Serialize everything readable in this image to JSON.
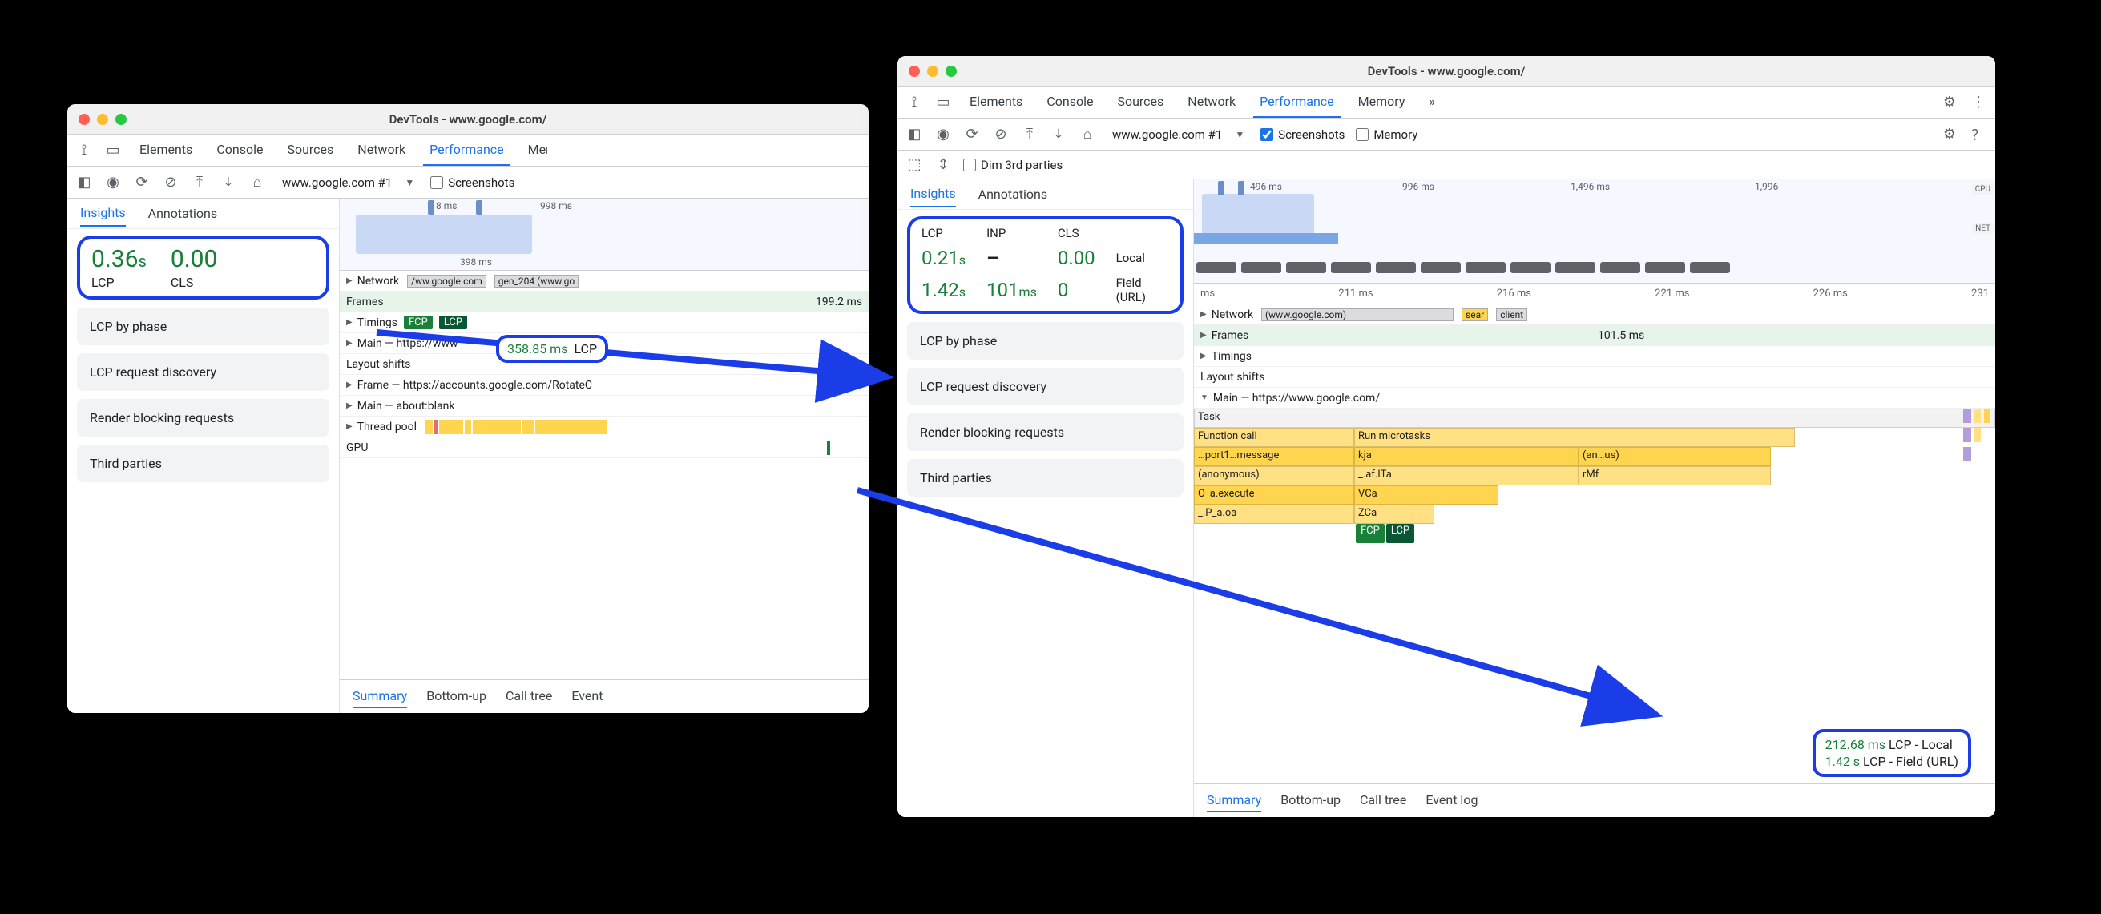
{
  "windowA": {
    "title": "DevTools - www.google.com/",
    "tabs": [
      "Elements",
      "Console",
      "Sources",
      "Network",
      "Performance",
      "Memory"
    ],
    "activeTab": "Performance",
    "profileDropdown": "www.google.com #1",
    "screenshots_label": "Screenshots",
    "insights_tabs": {
      "a": "Insights",
      "b": "Annotations"
    },
    "metrics": {
      "lcp_val": "0.36",
      "lcp_unit": "s",
      "lcp_label": "LCP",
      "cls_val": "0.00",
      "cls_label": "CLS"
    },
    "insightCards": [
      "LCP by phase",
      "LCP request discovery",
      "Render blocking requests",
      "Third parties"
    ],
    "minimap_ticks": {
      "a": "8 ms",
      "b": "998 ms",
      "c": "398 ms"
    },
    "tracks": {
      "network": "Network",
      "net_seg1": "/ww.google.com",
      "net_seg2": "gen_204 (www.go",
      "frames": "Frames",
      "frames_val": "199.2 ms",
      "timings": "Timings",
      "fcp": "FCP",
      "lcp": "LCP",
      "main": "Main — https://www",
      "layoutshifts": "Layout shifts",
      "frame": "Frame — https://accounts.google.com/RotateC",
      "main2": "Main — about:blank",
      "threadpool": "Thread pool",
      "gpu": "GPU"
    },
    "callout": {
      "ms": "358.85 ms",
      "label": "LCP"
    },
    "bottomTabs": [
      "Summary",
      "Bottom-up",
      "Call tree",
      "Event"
    ]
  },
  "windowB": {
    "title": "DevTools - www.google.com/",
    "tabs": [
      "Elements",
      "Console",
      "Sources",
      "Network",
      "Performance",
      "Memory"
    ],
    "more": "»",
    "activeTab": "Performance",
    "profileDropdown": "www.google.com #1",
    "screenshots_label": "Screenshots",
    "memory_label": "Memory",
    "dim_label": "Dim 3rd parties",
    "insights_tabs": {
      "a": "Insights",
      "b": "Annotations"
    },
    "metricsTable": {
      "h_lcp": "LCP",
      "h_inp": "INP",
      "h_cls": "CLS",
      "r1_lcp": "0.21",
      "r1_lcp_u": "s",
      "r1_inp": "–",
      "r1_cls": "0.00",
      "r1_side": "Local",
      "r2_lcp": "1.42",
      "r2_lcp_u": "s",
      "r2_inp": "101",
      "r2_inp_u": "ms",
      "r2_cls": "0",
      "r2_side": "Field (URL)"
    },
    "insightCards": [
      "LCP by phase",
      "LCP request discovery",
      "Render blocking requests",
      "Third parties"
    ],
    "minimap_ticks": {
      "a": "496 ms",
      "b": "996 ms",
      "c": "1,496 ms",
      "d": "1,996"
    },
    "mm_labels": {
      "cpu": "CPU",
      "net": "NET"
    },
    "ruler": [
      "ms",
      "211 ms",
      "216 ms",
      "221 ms",
      "226 ms",
      "231"
    ],
    "tracks": {
      "network": "Network",
      "net_seg1": "(www.google.com)",
      "net_seg2": "sear",
      "net_seg3": "client",
      "frames": "Frames",
      "frames_val": "101.5 ms",
      "timings": "Timings",
      "layoutshifts": "Layout shifts",
      "main": "Main — https://www.google.com/",
      "task": "Task",
      "fcall": "Function call",
      "microtasks": "Run microtasks",
      "port": "…port1…message",
      "kja": "kja",
      "anus": "(an…us)",
      "anon": "(anonymous)",
      "afita": "_.af.ITa",
      "rmf": "rMf",
      "oexec": "O_a.execute",
      "vca": "VCa",
      "paoa": "_.P_a.oa",
      "zca": "ZCa",
      "fcp": "FCP",
      "lcp": "LCP"
    },
    "callout": {
      "l1_ms": "212.68 ms",
      "l1_label": "LCP - Local",
      "l2_ms": "1.42 s",
      "l2_label": "LCP - Field (URL)"
    },
    "bottomTabs": [
      "Summary",
      "Bottom-up",
      "Call tree",
      "Event log"
    ]
  }
}
